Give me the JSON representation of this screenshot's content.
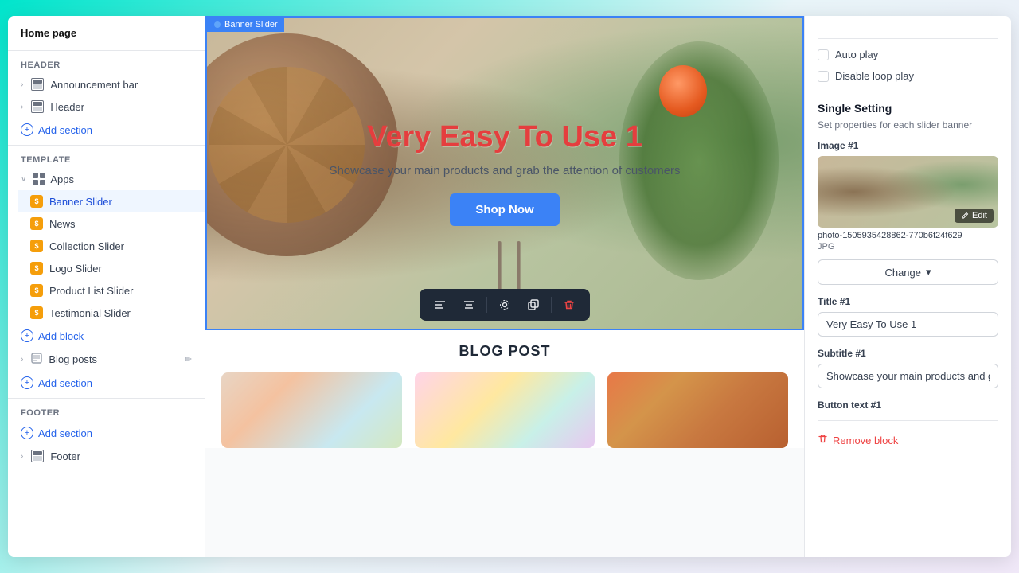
{
  "sidebar": {
    "page_title": "Home page",
    "header_section": "Header",
    "header_items": [
      {
        "label": "Announcement bar",
        "id": "announcement-bar"
      },
      {
        "label": "Header",
        "id": "header"
      }
    ],
    "add_section_header": "Add section",
    "template_section": "Template",
    "apps_label": "Apps",
    "apps_blocks": [
      {
        "label": "Banner Slider",
        "active": true
      },
      {
        "label": "News",
        "active": false
      },
      {
        "label": "Collection Slider",
        "active": false
      },
      {
        "label": "Logo Slider",
        "active": false
      },
      {
        "label": "Product List Slider",
        "active": false
      },
      {
        "label": "Testimonial Slider",
        "active": false
      }
    ],
    "add_block_label": "Add block",
    "blog_posts_label": "Blog posts",
    "add_section_template": "Add section",
    "footer_section": "Footer",
    "add_section_footer": "Add section",
    "footer_label": "Footer"
  },
  "banner": {
    "label": "Banner Slider",
    "title": "Very Easy To Use 1",
    "subtitle": "Showcase your main products and grab the attention of customers",
    "shop_now": "Shop Now"
  },
  "blog_post": {
    "label": "BLOG POST"
  },
  "toolbar": {
    "buttons": [
      "align-left",
      "align-center",
      "settings",
      "duplicate",
      "delete"
    ]
  },
  "right_panel": {
    "auto_play_label": "Auto play",
    "disable_loop_label": "Disable loop play",
    "single_setting_title": "Single Setting",
    "single_setting_desc": "Set properties for each slider banner",
    "image_label": "Image #1",
    "image_filename": "photo-1505935428862-770b6f24f629",
    "image_format": "JPG",
    "edit_label": "Edit",
    "change_label": "Change",
    "title_label": "Title #1",
    "title_value": "Very Easy To Use 1",
    "subtitle_label": "Subtitle #1",
    "subtitle_value": "Showcase your main products and grab",
    "button_text_label": "Button text #1",
    "remove_block_label": "Remove block"
  }
}
